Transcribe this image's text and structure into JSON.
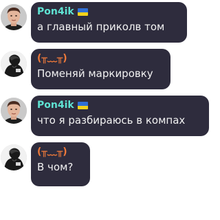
{
  "messages": [
    {
      "sender": "Pon4ik",
      "sender_color": "#5fe3d3",
      "flag_icon": "ukraine-flag-icon",
      "flag_colors": [
        "#2f6fd6",
        "#f4d21a"
      ],
      "avatar_icon": "man-portrait-avatar",
      "text": "а главный приколв том"
    },
    {
      "sender": "(╥﹏╥)",
      "sender_color": "#f07a3a",
      "avatar_icon": "dark-figure-avatar",
      "text": "Поменяй маркировку"
    },
    {
      "sender": "Pon4ik",
      "sender_color": "#5fe3d3",
      "flag_icon": "ukraine-flag-icon",
      "flag_colors": [
        "#2f6fd6",
        "#f4d21a"
      ],
      "avatar_icon": "man-portrait-avatar",
      "text": "что я разбираюсь в компах"
    },
    {
      "sender": "(╥﹏╥)",
      "sender_color": "#f07a3a",
      "avatar_icon": "dark-figure-avatar",
      "text": "В чом?"
    }
  ]
}
